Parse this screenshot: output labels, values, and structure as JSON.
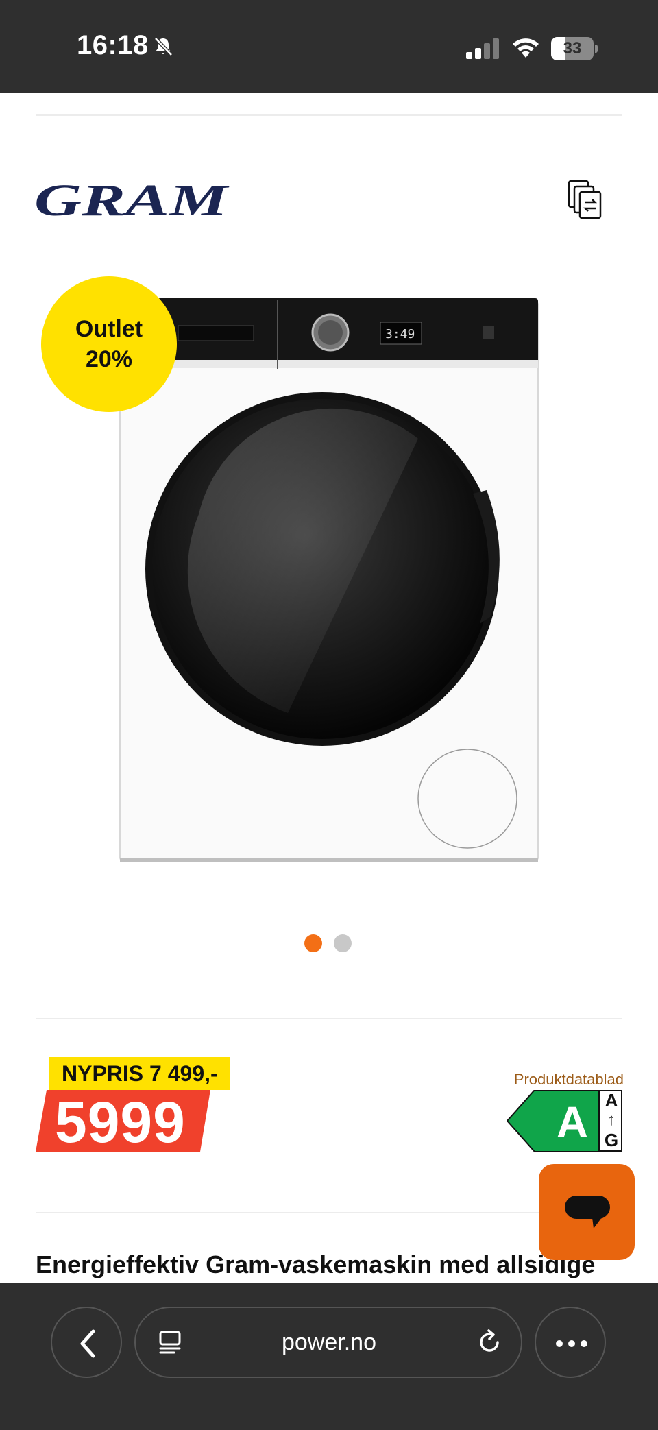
{
  "status_bar": {
    "time": "16:18",
    "battery_percent": "33",
    "battery_level": 0.33,
    "icons": [
      "bell-slash-icon",
      "cellular-signal-icon",
      "wifi-icon",
      "battery-icon"
    ]
  },
  "brand": {
    "name": "GRAM",
    "compare_icon": "compare-icon"
  },
  "badge": {
    "line1": "Outlet",
    "line2": "20%"
  },
  "carousel": {
    "total": 2,
    "active": 1
  },
  "price": {
    "nypris": "NYPRIS 7 499,-",
    "current": "5999",
    "datasheet_link": "Produktdatablad",
    "energy_class": "A",
    "energy_scale_top": "A",
    "energy_scale_bottom": "G"
  },
  "product": {
    "title": "Energieffektiv Gram-vaskemaskin med allsidige"
  },
  "browser": {
    "url": "power.no",
    "icons": [
      "back-icon",
      "tabs-icon",
      "reload-icon",
      "more-icon"
    ]
  },
  "colors": {
    "status_bar": "#2f2f2f",
    "accent_orange": "#e8650e",
    "badge_yellow": "#ffe100",
    "price_red": "#f0412c",
    "energy_green": "#10a54a",
    "brand_navy": "#1b2552"
  }
}
